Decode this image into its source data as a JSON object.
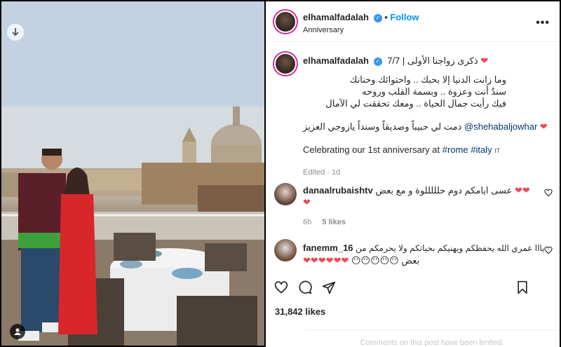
{
  "post": {
    "username": "elhamalfadalah",
    "follow_label": "Follow",
    "location": "Anniversary",
    "more_label": "•••"
  },
  "caption": {
    "title_line": "ذكرى زواجنا الأولى | 7/7",
    "line1": "وما زانت الدنيا إلا بحبك .. واحتوائك وحنانك",
    "line2": "سندٌ أنت وعزوة .. وبسمة القلب وروحه",
    "line3": "فيك رأيت جمال الحياة .. ومعك تحققت لي الآمال",
    "mention_line_text": "دمت لي حبيباً وصديقاً وسنداً يازوجي العزيز",
    "mention": "@shehabaljowhar",
    "english_prefix": "Celebrating our 1st anniversary at",
    "tag_rome": "#rome",
    "tag_italy": "#italy",
    "flag": "IT",
    "meta": "Edited · 1d"
  },
  "comments": [
    {
      "username": "danaalrubaishtv",
      "text": "عسى ايامكم دوم حلللللوة و مع بعض",
      "hearts": "❤❤",
      "hearts2": "❤",
      "time": "6h",
      "likes": "5 likes"
    },
    {
      "username": "fanemm_16",
      "text": "يااا عمري الله يحفظكم ويهنيكم بحياتكم ولا يحرمكم من",
      "hearts": "❤❤❤❤❤❤",
      "text2": "بعض",
      "emojis": "😶😶😶😶😶"
    }
  ],
  "likes_count": "31,842 likes",
  "footer": "Comments on this post have been limited."
}
